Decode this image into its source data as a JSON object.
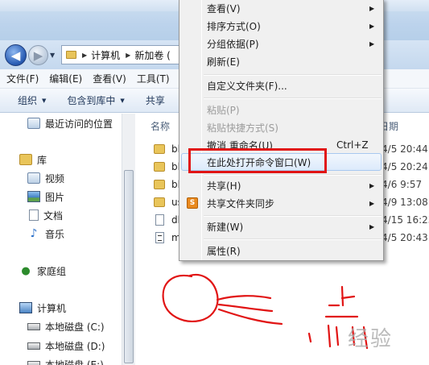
{
  "window": {
    "breadcrumb": [
      "计算机",
      "新加卷 ("
    ]
  },
  "menubar": {
    "items": [
      "文件(F)",
      "编辑(E)",
      "查看(V)",
      "工具(T)"
    ]
  },
  "toolbar": {
    "organize": "组织",
    "include_in_library": "包含到库中",
    "share": "共享"
  },
  "nav_pane": {
    "recent": "最近访问的位置",
    "libraries": "库",
    "videos": "视频",
    "pictures": "图片",
    "documents": "文档",
    "music": "音乐",
    "homegroup": "家庭组",
    "computer": "计算机",
    "disk_c": "本地磁盘 (C:)",
    "disk_d": "本地磁盘 (D:)",
    "disk_e": "本地磁盘 (E:)"
  },
  "file_list": {
    "col_name": "名称",
    "col_date": "日期",
    "rows": [
      {
        "name": "bl",
        "date": "/4/5 20:44",
        "kind": "folder"
      },
      {
        "name": "bl",
        "date": "/4/5 20:24",
        "kind": "folder"
      },
      {
        "name": "bl",
        "date": "/4/6 9:57",
        "kind": "folder"
      },
      {
        "name": "us",
        "date": "/4/9 13:08",
        "kind": "folder"
      },
      {
        "name": "db",
        "date": "/4/15 16:23",
        "kind": "file"
      },
      {
        "name": "m",
        "date": "/4/5 20:43",
        "kind": "script"
      }
    ]
  },
  "context_menu": {
    "view": "查看(V)",
    "sort_by": "排序方式(O)",
    "group_by": "分组依据(P)",
    "refresh": "刷新(E)",
    "customize_folder": "自定义文件夹(F)...",
    "paste": "粘贴(P)",
    "paste_shortcut": "粘贴快捷方式(S)",
    "undo_rename": "撤消 重命名(U)",
    "undo_shortcut": "Ctrl+Z",
    "open_cmd_here": "在此处打开命令窗口(W)",
    "share_with": "共享(H)",
    "share_folder_sync": "共享文件夹同步",
    "new": "新建(W)",
    "properties": "属性(R)"
  },
  "annotation": {
    "highlight_color": "#e11414",
    "watermark": "经验"
  },
  "colors": {
    "menu_bg": "#f0f0f0",
    "hover_border": "#a8c8ef",
    "disabled_text": "#9c9c9c"
  }
}
